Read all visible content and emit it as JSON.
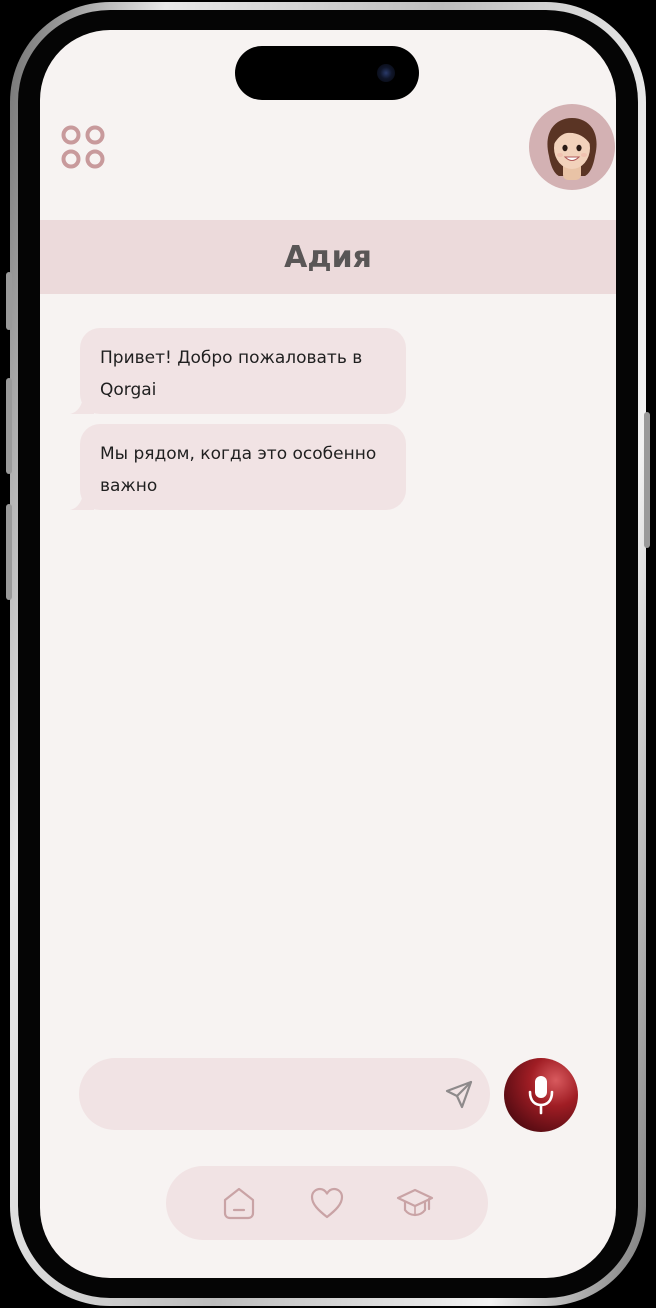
{
  "app": {
    "colors": {
      "screen_bg": "#f7f3f2",
      "title_bar_bg": "#ecdadb",
      "bubble_bg": "#f1e3e4",
      "accent_rose": "#c89a9c",
      "mic_red": "#a01d24"
    }
  },
  "header": {
    "menu_icon": "apps-grid-icon",
    "avatar_icon": "user-avatar-icon"
  },
  "chat": {
    "title": "Адия",
    "messages": [
      {
        "text": "Привет! Добро пожаловать в Qorgai"
      },
      {
        "text": "Мы рядом, когда это особенно важно"
      }
    ]
  },
  "composer": {
    "input_value": "",
    "send_icon": "send-icon",
    "mic_icon": "microphone-icon"
  },
  "nav": {
    "items": [
      {
        "icon": "home-icon"
      },
      {
        "icon": "heart-icon"
      },
      {
        "icon": "graduation-cap-icon"
      }
    ]
  }
}
